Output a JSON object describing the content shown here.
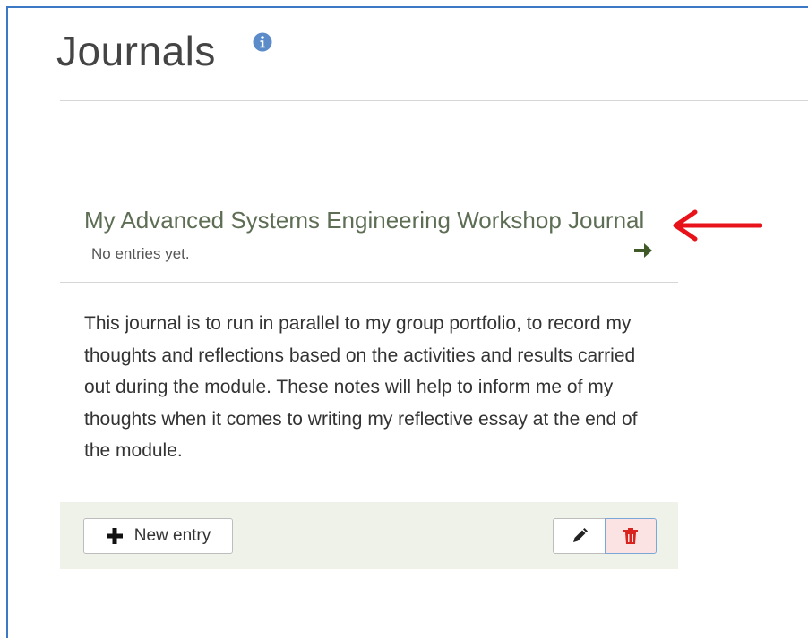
{
  "page": {
    "title": "Journals"
  },
  "journal": {
    "title": "My Advanced Systems Engineering Workshop Journal",
    "status": "No entries yet.",
    "description": "This journal is to run in parallel to my group portfolio, to record my thoughts and reflections based on the activities and results carried out during the module. These notes will help to inform me of my thoughts when it comes to writing my reflective essay at the end of the module."
  },
  "actions": {
    "new_entry_label": "New entry"
  },
  "icons": {
    "info": "info-circle-icon",
    "open_journal": "arrow-right-icon",
    "annotation": "red-arrow-annotation",
    "new_entry": "plus-icon",
    "edit": "pencil-icon",
    "delete": "trash-icon"
  },
  "colors": {
    "frame_border": "#3c78c4",
    "info_icon": "#5b8bc9",
    "journal_title": "#5e6e55",
    "open_arrow": "#3f5a28",
    "annotation_arrow": "#e8131a",
    "footer_bg": "#eef2e8",
    "delete_icon": "#d9231f"
  }
}
